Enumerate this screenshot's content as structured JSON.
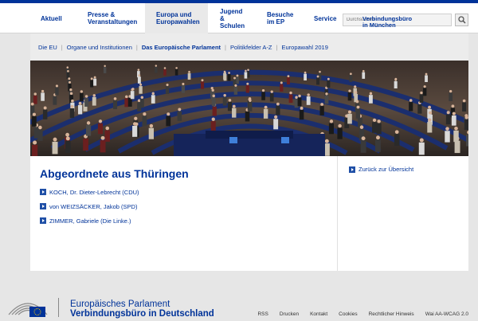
{
  "nav": {
    "items": [
      {
        "label": "Aktuell"
      },
      {
        "label": "Presse &\nVeranstaltungen"
      },
      {
        "label": "Europa und\nEuropawahlen"
      },
      {
        "label": "Jugend\n&\nSchulen"
      },
      {
        "label": "Besuche\nim EP"
      },
      {
        "label": "Service"
      }
    ],
    "search_overlay": "Verbindungsbüro\nin München",
    "search_placeholder": "Durchsuchen"
  },
  "subnav": {
    "items": [
      "Die EU",
      "Organe und Institutionen",
      "Das Europäische Parlament",
      "Politikfelder A-Z",
      "Europawahl 2019"
    ]
  },
  "main": {
    "title": "Abgeordnete aus Thüringen",
    "members": [
      "KOCH, Dr. Dieter-Lebrecht (CDU)",
      "von WEIZSÄCKER, Jakob (SPD)",
      "ZIMMER, Gabriele (Die Linke.)"
    ]
  },
  "side": {
    "back_label": "Zurück zur Übersicht"
  },
  "footer": {
    "title_line1": "Europäisches Parlament",
    "title_line2": "Verbindungsbüro in Deutschland",
    "links": [
      "RSS",
      "Drucken",
      "Kontakt",
      "Cookies",
      "Rechtlicher Hinweis",
      "Wai AA-WCAG 2.0"
    ]
  },
  "colors": {
    "brand": "#003399",
    "seat": "#1b2e6e"
  },
  "icons": {
    "search": "magnifier-icon",
    "arrow": "arrow-right-icon",
    "logo": "ep-logo-icon"
  }
}
